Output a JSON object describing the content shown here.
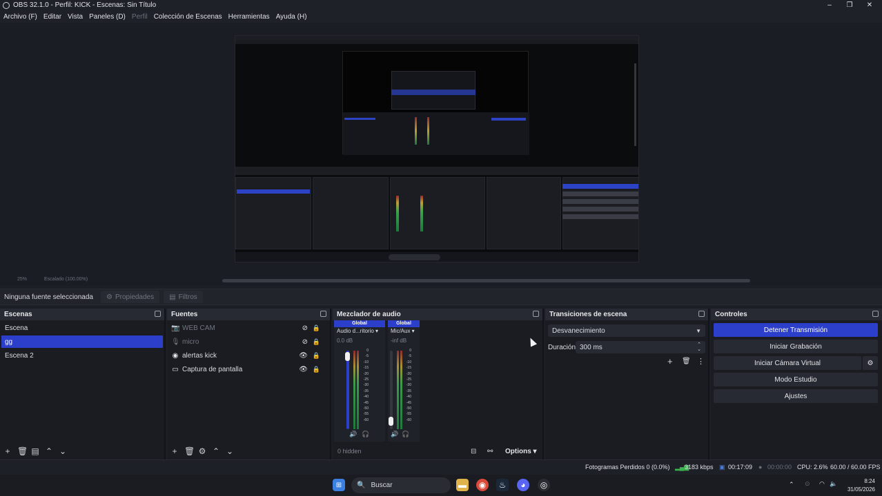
{
  "window": {
    "title": "OBS 32.1.0 - Perfil: KICK - Escenas: Sin Título",
    "minimize": "–",
    "maximize": "❐",
    "close": "✕"
  },
  "menu": [
    "Archivo (F)",
    "Editar",
    "Vista",
    "Paneles (D)",
    "Perfil",
    "Colección de Escenas",
    "Herramientas",
    "Ayuda (H)"
  ],
  "preview_strip": {
    "zoom": "25%",
    "label": "Escalado (100.00%)"
  },
  "source_toolbar": {
    "no_selection": "Ninguna fuente seleccionada",
    "properties": "Propiedades",
    "filters": "Filtros"
  },
  "scenes": {
    "title": "Escenas",
    "items": [
      "Escena",
      "gg",
      "Escena 2"
    ],
    "selected_index": 1
  },
  "sources": {
    "title": "Fuentes",
    "items": [
      {
        "name": "WEB CAM",
        "icon": "camera-icon",
        "visible": false,
        "locked": true
      },
      {
        "name": "micro",
        "icon": "microphone-icon",
        "visible": false,
        "locked": true
      },
      {
        "name": "alertas kick",
        "icon": "globe-icon",
        "visible": true,
        "locked": true
      },
      {
        "name": "Captura de pantalla",
        "icon": "monitor-icon",
        "visible": true,
        "locked": true
      }
    ]
  },
  "mixer": {
    "title": "Mezclador de audio",
    "channels": [
      {
        "badge": "Global",
        "name": "Audio d...ritorio",
        "db": "0.0 dB",
        "volume": 0.98
      },
      {
        "badge": "Global",
        "name": "Mic/Aux",
        "db": "-inf dB",
        "volume": 0.05
      }
    ],
    "hidden": "0 hidden",
    "options": "Options",
    "ticks": [
      "0",
      "-5",
      "-10",
      "-15",
      "-20",
      "-25",
      "-30",
      "-35",
      "-40",
      "-45",
      "-50",
      "-55",
      "-60"
    ]
  },
  "transitions": {
    "title": "Transiciones de escena",
    "type": "Desvanecimiento",
    "duration_label": "Duración",
    "duration_value": "300 ms"
  },
  "controls": {
    "title": "Controles",
    "buttons": [
      "Detener Transmisión",
      "Iniciar Grabación",
      "Iniciar Cámara Virtual",
      "Modo Estudio",
      "Ajustes"
    ]
  },
  "status": {
    "dropped": "Fotogramas Perdidos 0 (0.0%)",
    "bitrate": "3183 kbps",
    "stream_time": "00:17:09",
    "rec_time": "00:00:00",
    "cpu": "CPU: 2.6%",
    "fps": "60.00 / 60.00 FPS"
  },
  "taskbar": {
    "search": "Buscar",
    "time": "8:24",
    "date": "31/05/2026"
  },
  "colors": {
    "accent": "#2b3fcb",
    "panel": "#1a1c22",
    "header": "#272a32"
  }
}
